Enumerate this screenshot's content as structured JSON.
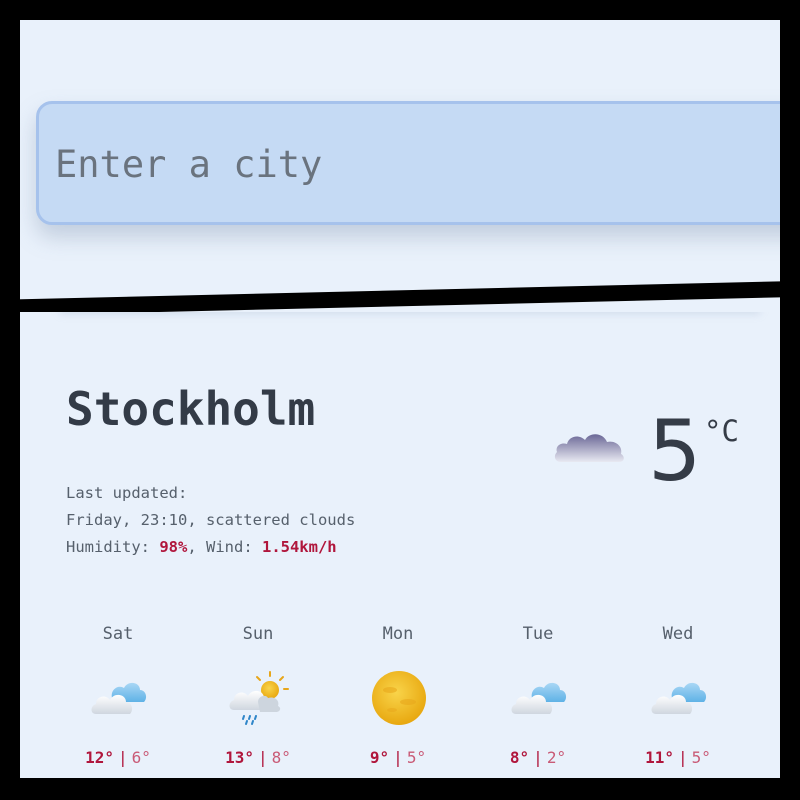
{
  "search": {
    "placeholder": "Enter a city"
  },
  "current": {
    "city": "Stockholm",
    "last_updated_label": "Last updated:",
    "updated_text": "Friday, 23:10, scattered clouds",
    "humidity_label": "Humidity: ",
    "humidity_value": "98%",
    "wind_label": ", Wind: ",
    "wind_value": "1.54km/h",
    "temperature": "5",
    "unit": "°C",
    "icon": "dark-cloud-icon"
  },
  "forecast": [
    {
      "day": "Sat",
      "high": "12°",
      "low": "6°",
      "separator": "|",
      "icon": "cloud-icon"
    },
    {
      "day": "Sun",
      "high": "13°",
      "low": "8°",
      "separator": "|",
      "icon": "sun-rain-cloud-icon"
    },
    {
      "day": "Mon",
      "high": "9°",
      "low": "5°",
      "separator": "|",
      "icon": "sun-icon"
    },
    {
      "day": "Tue",
      "high": "8°",
      "low": "2°",
      "separator": "|",
      "icon": "cloud-icon"
    },
    {
      "day": "Wed",
      "high": "11°",
      "low": "5°",
      "separator": "|",
      "icon": "cloud-icon"
    }
  ],
  "colors": {
    "background": "#e9f1fb",
    "search_bg": "#c5daf4",
    "accent": "#b0163c",
    "text": "#333b47"
  }
}
